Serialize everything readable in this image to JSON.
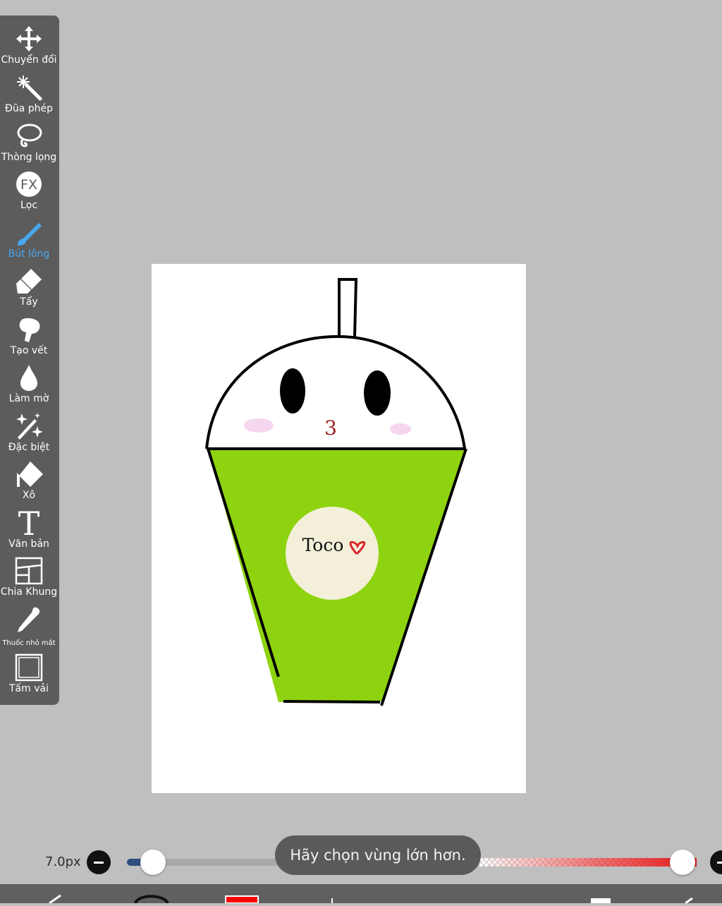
{
  "toolbar": {
    "items": [
      {
        "label": "Chuyển đổi",
        "icon": "move-icon"
      },
      {
        "label": "Đũa phép",
        "icon": "magic-wand-icon"
      },
      {
        "label": "Thòng lọng",
        "icon": "lasso-icon"
      },
      {
        "label": "Lọc",
        "icon": "fx-filter-icon"
      },
      {
        "label": "Bút lông",
        "icon": "brush-icon",
        "active": true
      },
      {
        "label": "Tẩy",
        "icon": "eraser-icon"
      },
      {
        "label": "Tạo vết",
        "icon": "smudge-icon"
      },
      {
        "label": "Làm mờ",
        "icon": "blur-drop-icon"
      },
      {
        "label": "Đặc biệt",
        "icon": "special-sparkle-icon"
      },
      {
        "label": "Xô",
        "icon": "bucket-icon"
      },
      {
        "label": "Văn bản",
        "icon": "text-icon"
      },
      {
        "label": "Chia Khung",
        "icon": "frame-divider-icon"
      },
      {
        "label": "Thuốc nhỏ mắt",
        "icon": "eyedropper-icon"
      },
      {
        "label": "Tấm vải",
        "icon": "canvas-icon"
      }
    ],
    "fx_text": "FX",
    "text_icon_glyph": "T"
  },
  "canvas": {
    "drawing": {
      "cup_text": "Toco",
      "mouth_text": "3",
      "cup_color": "#8ed30f",
      "label_color": "#f3efd9",
      "heart_color": "#d9262a",
      "blush_color": "#f5d6ef"
    }
  },
  "brush_controls": {
    "size_value": "7.0px",
    "size_fraction": 0.05,
    "opacity_fraction": 1.0,
    "brush_color": "#e01818"
  },
  "toast": {
    "message": "Hãy chọn vùng lớn hơn."
  },
  "colors": {
    "background": "#bfbfbf",
    "toolbar": "#5c5c5c",
    "active_tool": "#49a7f0"
  }
}
